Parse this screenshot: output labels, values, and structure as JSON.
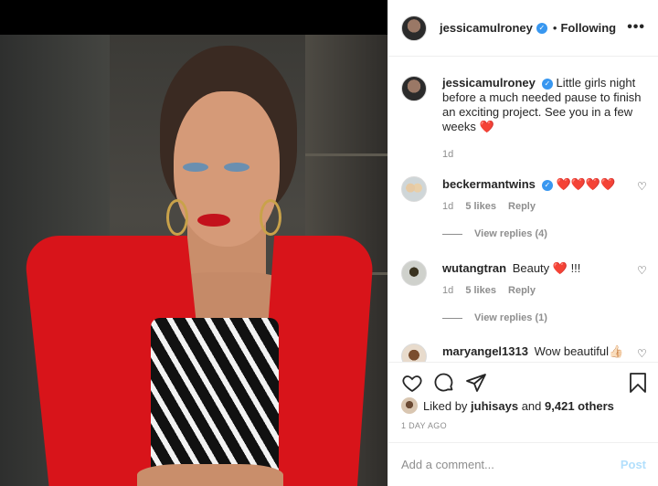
{
  "post": {
    "author": "jessicamulroney",
    "follow_status": "Following",
    "more_label": "•••"
  },
  "caption": {
    "username": "jessicamulroney",
    "text": "Little girls night before a much needed pause to finish an exciting project. See you in a few weeks",
    "emoji": "❤️",
    "time": "1d"
  },
  "comments": [
    {
      "username": "beckermantwins",
      "verified": true,
      "text": "❤️❤️❤️❤️",
      "time": "1d",
      "likes": "5 likes",
      "reply": "Reply",
      "view_replies": "View replies (4)"
    },
    {
      "username": "wutangtran",
      "verified": false,
      "text": "Beauty ❤️ !!!",
      "time": "1d",
      "likes": "5 likes",
      "reply": "Reply",
      "view_replies": "View replies (1)"
    },
    {
      "username": "maryangel1313",
      "verified": false,
      "text": "Wow beautiful👍🏻"
    }
  ],
  "likes": {
    "prefix": "Liked by",
    "liker": "juhisays",
    "joiner": "and",
    "others": "9,421 others"
  },
  "timestamp": "1 DAY AGO",
  "composer": {
    "placeholder": "Add a comment...",
    "post_label": "Post"
  },
  "icons": {
    "verified": "verified-badge-icon",
    "like": "heart-icon",
    "comment": "comment-bubble-icon",
    "share": "paper-plane-icon",
    "save": "bookmark-icon",
    "more": "more-options-icon"
  },
  "colors": {
    "verified": "#3897f0",
    "heart_red": "#ed1c24",
    "post_disabled": "#b2dffc",
    "muted_text": "#8e8e8e"
  }
}
